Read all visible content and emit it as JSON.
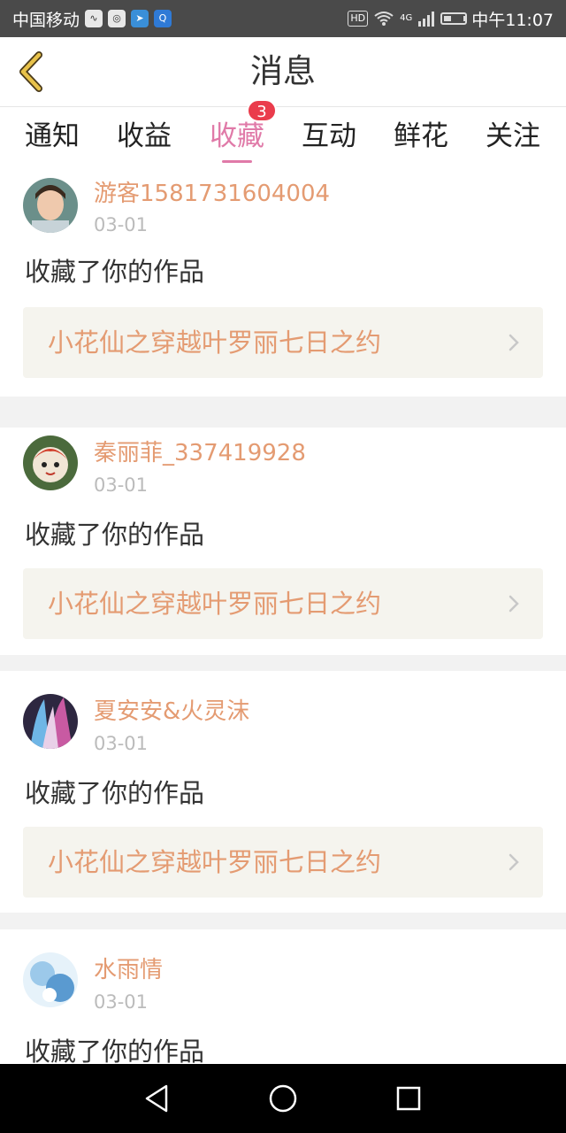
{
  "status_bar": {
    "carrier": "中国移动",
    "time": "中午11:07",
    "hd": "HD",
    "net": "4G",
    "colors": {
      "bg": "#4a4a4a"
    }
  },
  "header": {
    "title": "消息",
    "back_icon": "chevron-left-icon"
  },
  "tabs": [
    {
      "label": "通知",
      "active": false
    },
    {
      "label": "收益",
      "active": false
    },
    {
      "label": "收藏",
      "active": true,
      "badge": "3"
    },
    {
      "label": "互动",
      "active": false
    },
    {
      "label": "鲜花",
      "active": false
    },
    {
      "label": "关注",
      "active": false
    }
  ],
  "items": [
    {
      "username": "游客1581731604004",
      "date": "03-01",
      "action": "收藏了你的作品",
      "work_title": "小花仙之穿越叶罗丽七日之约"
    },
    {
      "username": "秦丽菲_337419928",
      "date": "03-01",
      "action": "收藏了你的作品",
      "work_title": "小花仙之穿越叶罗丽七日之约"
    },
    {
      "username": "夏安安&火灵沫",
      "date": "03-01",
      "action": "收藏了你的作品",
      "work_title": "小花仙之穿越叶罗丽七日之约"
    },
    {
      "username": "水雨情",
      "date": "03-01",
      "action": "收藏了你的作品",
      "work_title": ""
    }
  ],
  "colors": {
    "accent": "#e07aa8",
    "name_color": "#e49b72",
    "badge": "#ea3c4c",
    "back_icon": "#e0b43c"
  },
  "nav": {
    "icons": [
      "back-triangle-icon",
      "home-circle-icon",
      "recents-square-icon"
    ]
  }
}
